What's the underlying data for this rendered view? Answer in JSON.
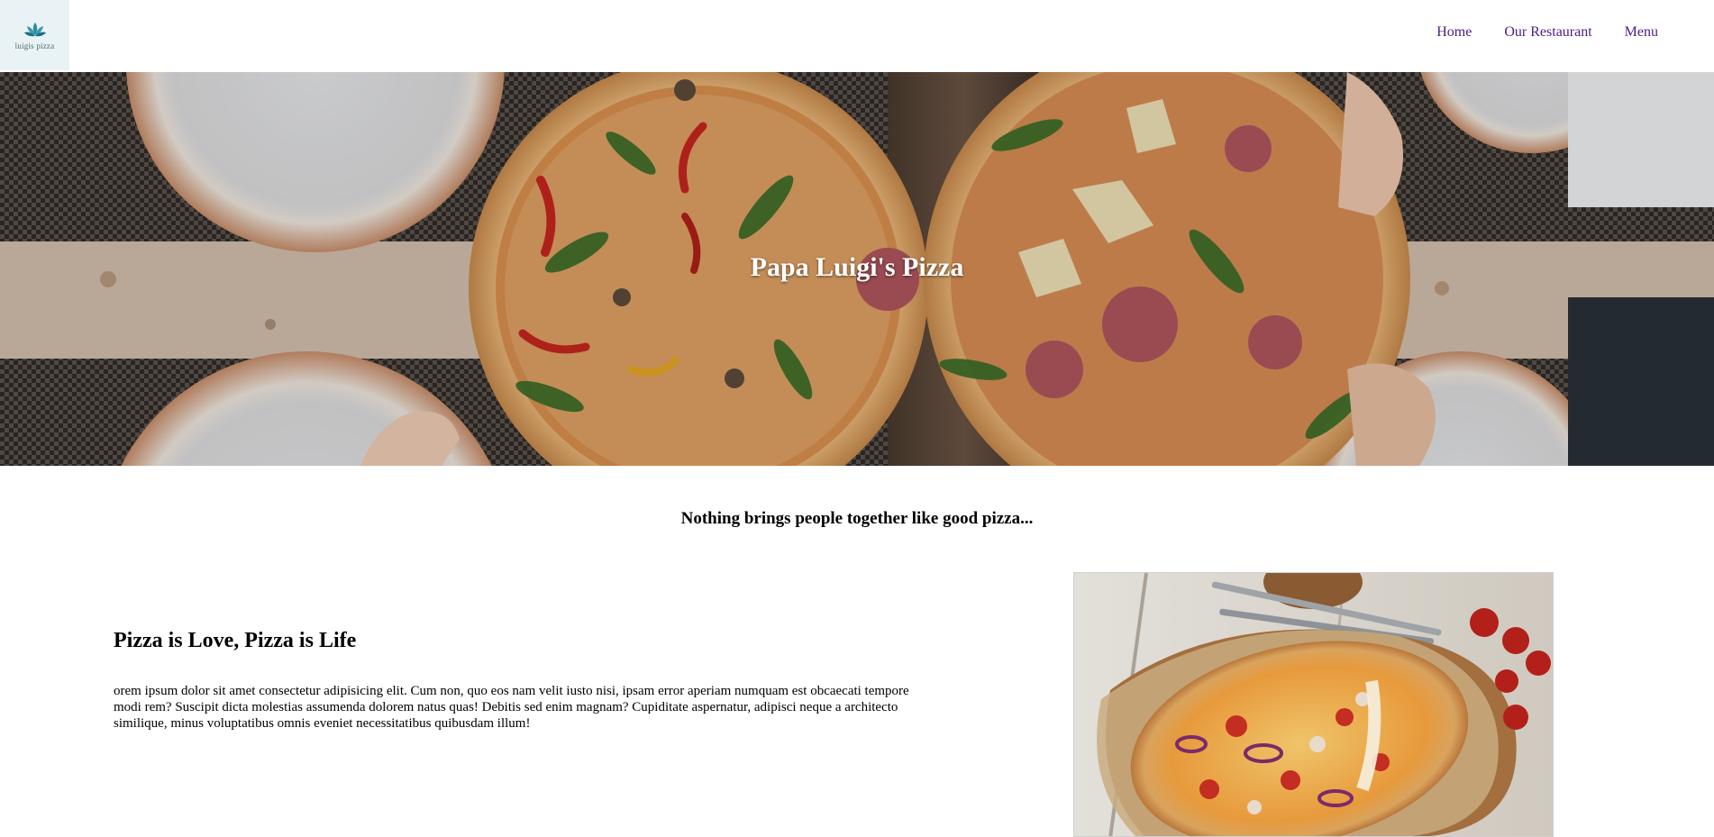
{
  "brand": {
    "logo_text": "luigis pizza",
    "logo_icon": "lotus-icon",
    "accent_color": "#2b8fa3"
  },
  "nav": {
    "items": [
      {
        "label": "Home"
      },
      {
        "label": "Our Restaurant"
      },
      {
        "label": "Menu"
      }
    ],
    "link_color": "#4b1d86"
  },
  "hero": {
    "title": "Papa Luigi's Pizza",
    "image": "pizza-table-photo"
  },
  "tagline": "Nothing brings people together like good pizza...",
  "section": {
    "heading": "Pizza is Love, Pizza is Life",
    "body": "orem ipsum dolor sit amet consectetur adipisicing elit. Cum non, quo eos nam velit iusto nisi, ipsam error aperiam numquam est obcaecati tempore modi rem? Suscipit dicta molestias assumenda dolorem natus quas! Debitis sed enim magnam? Cupiditate aspernatur, adipisci neque a architecto similique, minus voluptatibus omnis eveniet necessitatibus quibusdam illum!",
    "image": "pizza-board-photo"
  }
}
